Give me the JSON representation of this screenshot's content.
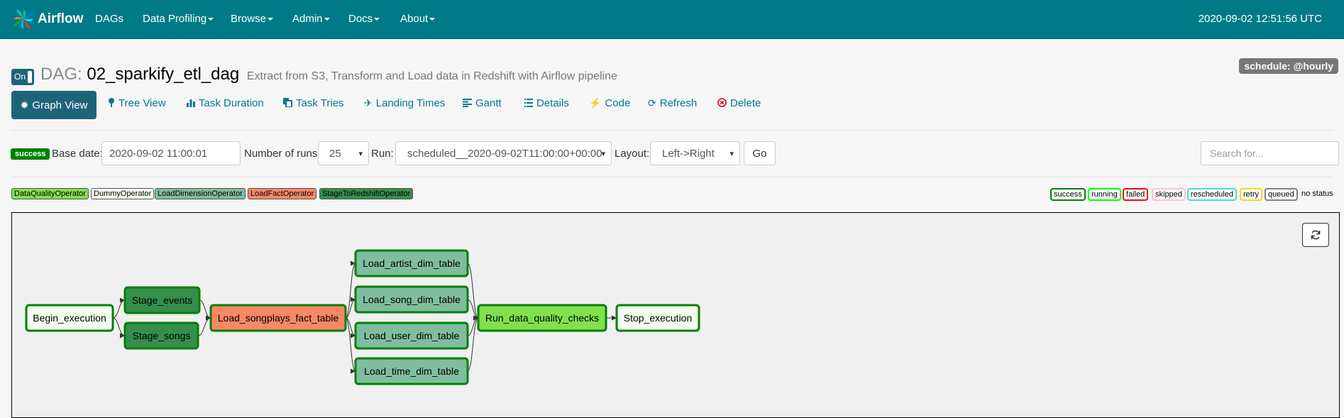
{
  "navbar": {
    "brand": "Airflow",
    "items": [
      {
        "label": "DAGs",
        "dropdown": false
      },
      {
        "label": "Data Profiling",
        "dropdown": true
      },
      {
        "label": "Browse",
        "dropdown": true
      },
      {
        "label": "Admin",
        "dropdown": true
      },
      {
        "label": "Docs",
        "dropdown": true
      },
      {
        "label": "About",
        "dropdown": true
      }
    ],
    "clock": "2020-09-02 12:51:56 UTC"
  },
  "dag": {
    "toggle": "On",
    "label": "DAG:",
    "id": "02_sparkify_etl_dag",
    "description": "Extract from S3, Transform and Load data in Redshift with Airflow pipeline",
    "schedule": "schedule: @hourly"
  },
  "tabs": [
    {
      "label": "Graph View",
      "icon": "sun-icon",
      "active": true
    },
    {
      "label": "Tree View",
      "icon": "tree-icon"
    },
    {
      "label": "Task Duration",
      "icon": "stats-icon"
    },
    {
      "label": "Task Tries",
      "icon": "duplicate-icon"
    },
    {
      "label": "Landing Times",
      "icon": "plane-icon"
    },
    {
      "label": "Gantt",
      "icon": "align-left-icon"
    },
    {
      "label": "Details",
      "icon": "list-icon"
    },
    {
      "label": "Code",
      "icon": "flash-icon"
    },
    {
      "label": "Refresh",
      "icon": "refresh-icon"
    },
    {
      "label": "Delete",
      "icon": "remove-circle-icon"
    }
  ],
  "controls": {
    "state_badge": "success",
    "base_date_label": "Base date:",
    "base_date_value": "2020-09-02 11:00:01",
    "num_runs_label": "Number of runs:",
    "num_runs_value": "25",
    "run_label": "Run:",
    "run_value": "scheduled__2020-09-02T11:00:00+00:00",
    "layout_label": "Layout:",
    "layout_value": "Left->Right",
    "go_label": "Go",
    "search_placeholder": "Search for..."
  },
  "operator_legend": [
    {
      "label": "DataQualityOperator",
      "color": "#82e04e"
    },
    {
      "label": "DummyOperator",
      "color": "#f4fff0"
    },
    {
      "label": "LoadDimensionOperator",
      "color": "#80bd9e"
    },
    {
      "label": "LoadFactOperator",
      "color": "#f98866"
    },
    {
      "label": "StageToRedshiftOperator",
      "color": "#358f4b"
    }
  ],
  "state_legend": [
    {
      "label": "success",
      "color": "#008000"
    },
    {
      "label": "running",
      "color": "#00ff00"
    },
    {
      "label": "failed",
      "color": "#ff0000"
    },
    {
      "label": "skipped",
      "color": "#ffc0cb"
    },
    {
      "label": "rescheduled",
      "color": "#40e0d0"
    },
    {
      "label": "retry",
      "color": "#ffd700"
    },
    {
      "label": "queued",
      "color": "#808080"
    }
  ],
  "no_status_label": "no status",
  "graph": {
    "nodes": [
      {
        "id": "begin",
        "label": "Begin_execution",
        "color": "#f4fff0"
      },
      {
        "id": "stage_events",
        "label": "Stage_events",
        "color": "#358f4b"
      },
      {
        "id": "stage_songs",
        "label": "Stage_songs",
        "color": "#358f4b"
      },
      {
        "id": "load_fact",
        "label": "Load_songplays_fact_table",
        "color": "#f98866"
      },
      {
        "id": "dim_artist",
        "label": "Load_artist_dim_table",
        "color": "#80bd9e"
      },
      {
        "id": "dim_song",
        "label": "Load_song_dim_table",
        "color": "#80bd9e"
      },
      {
        "id": "dim_user",
        "label": "Load_user_dim_table",
        "color": "#80bd9e"
      },
      {
        "id": "dim_time",
        "label": "Load_time_dim_table",
        "color": "#80bd9e"
      },
      {
        "id": "dq",
        "label": "Run_data_quality_checks",
        "color": "#82e04e"
      },
      {
        "id": "stop",
        "label": "Stop_execution",
        "color": "#f4fff0"
      }
    ],
    "edges": [
      [
        "begin",
        "stage_events"
      ],
      [
        "begin",
        "stage_songs"
      ],
      [
        "stage_events",
        "load_fact"
      ],
      [
        "stage_songs",
        "load_fact"
      ],
      [
        "load_fact",
        "dim_artist"
      ],
      [
        "load_fact",
        "dim_song"
      ],
      [
        "load_fact",
        "dim_user"
      ],
      [
        "load_fact",
        "dim_time"
      ],
      [
        "dim_artist",
        "dq"
      ],
      [
        "dim_song",
        "dq"
      ],
      [
        "dim_user",
        "dq"
      ],
      [
        "dim_time",
        "dq"
      ],
      [
        "dq",
        "stop"
      ]
    ]
  }
}
